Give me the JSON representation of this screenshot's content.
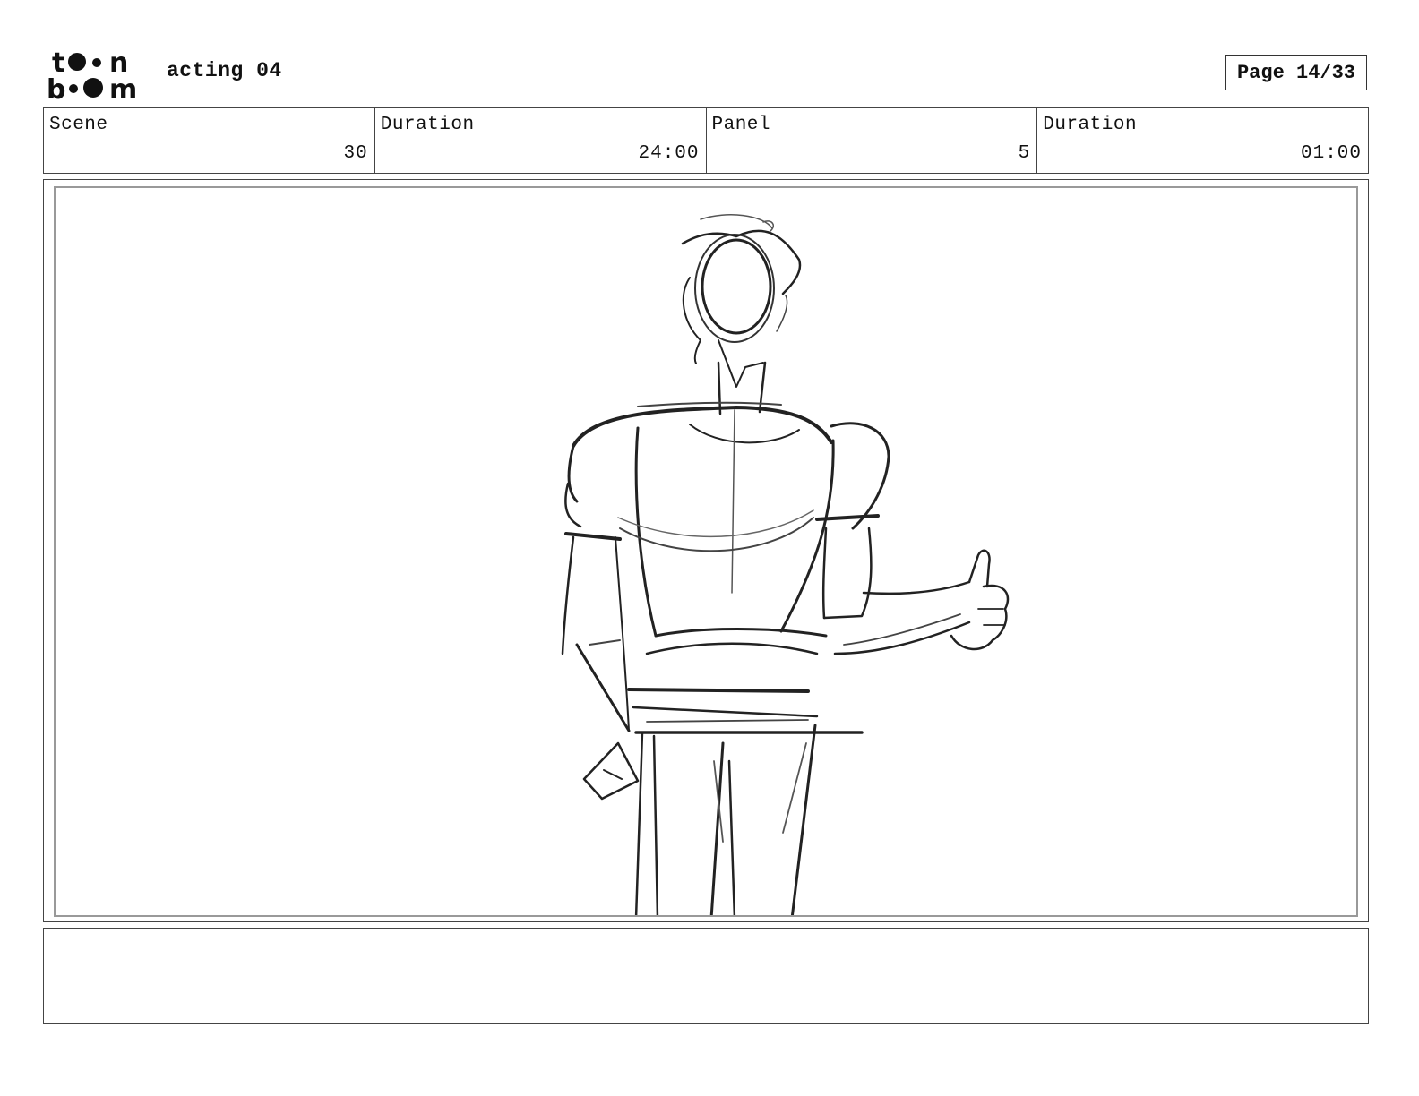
{
  "brand": {
    "logo_line1": "toon",
    "logo_line2": "boom"
  },
  "header": {
    "title": "acting 04",
    "page": "Page 14/33"
  },
  "info": {
    "scene_label": "Scene",
    "scene_value": "30",
    "scene_duration_label": "Duration",
    "scene_duration_value": "24:00",
    "panel_label": "Panel",
    "panel_value": "5",
    "panel_duration_label": "Duration",
    "panel_duration_value": "01:00"
  },
  "notes": {
    "text": ""
  }
}
